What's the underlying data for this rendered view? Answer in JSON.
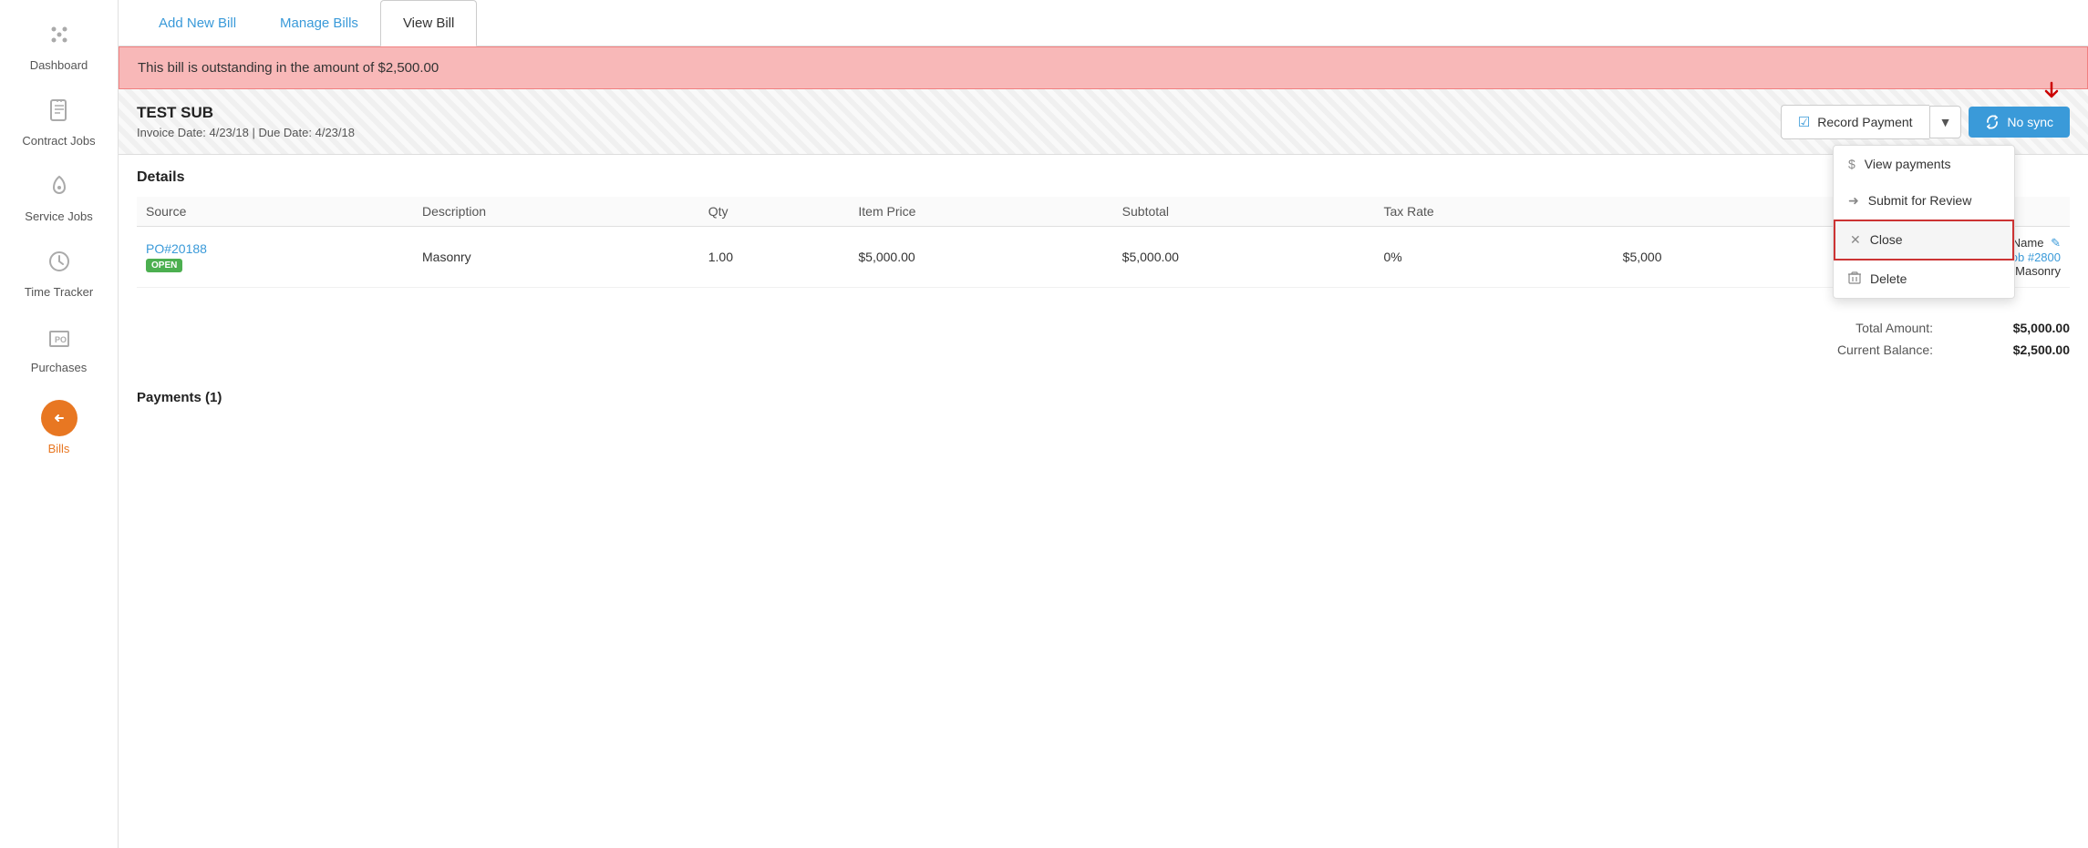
{
  "sidebar": {
    "items": [
      {
        "id": "dashboard",
        "label": "Dashboard",
        "icon": "⊞",
        "active": false
      },
      {
        "id": "contract-jobs",
        "label": "Contract Jobs",
        "icon": "📄",
        "active": false
      },
      {
        "id": "service-jobs",
        "label": "Service Jobs",
        "icon": "📍",
        "active": false
      },
      {
        "id": "time-tracker",
        "label": "Time Tracker",
        "icon": "🕐",
        "active": false
      },
      {
        "id": "purchases",
        "label": "Purchases",
        "icon": "PO",
        "active": false
      },
      {
        "id": "bills",
        "label": "Bills",
        "icon": "←",
        "active": true
      }
    ]
  },
  "tabs": [
    {
      "id": "add-new-bill",
      "label": "Add New Bill",
      "active": false
    },
    {
      "id": "manage-bills",
      "label": "Manage Bills",
      "active": false
    },
    {
      "id": "view-bill",
      "label": "View Bill",
      "active": true
    }
  ],
  "alert": {
    "message": "This bill is outstanding in the amount of $2,500.00"
  },
  "bill": {
    "title": "TEST SUB",
    "invoice_date": "4/23/18",
    "due_date": "4/23/18",
    "dates_label": "Invoice Date: 4/23/18 | Due Date: 4/23/18"
  },
  "actions": {
    "record_payment_label": "Record Payment",
    "no_sync_label": "No sync"
  },
  "dropdown_menu": {
    "items": [
      {
        "id": "view-payments",
        "label": "View payments",
        "icon": "$"
      },
      {
        "id": "submit-review",
        "label": "Submit for Review",
        "icon": "→"
      },
      {
        "id": "close",
        "label": "Close",
        "icon": "✕",
        "highlighted": true
      },
      {
        "id": "delete",
        "label": "Delete",
        "icon": "🗑"
      }
    ]
  },
  "details": {
    "section_title": "Details",
    "columns": [
      "Source",
      "Description",
      "Qty",
      "Item Price",
      "Subtotal",
      "Tax Rate",
      ""
    ],
    "rows": [
      {
        "source": "PO#20188",
        "source_badge": "OPEN",
        "description": "Masonry",
        "qty": "1.00",
        "item_price": "$5,000.00",
        "subtotal": "$5,000.00",
        "tax_rate": "0%",
        "amount": "$5,000",
        "right_name": "Name",
        "right_job": "Job #2800",
        "right_desc": "Masonry"
      }
    ]
  },
  "totals": {
    "total_amount_label": "Total Amount:",
    "total_amount_value": "$5,000.00",
    "current_balance_label": "Current Balance:",
    "current_balance_value": "$2,500.00"
  },
  "payments": {
    "title": "Payments (1)"
  }
}
